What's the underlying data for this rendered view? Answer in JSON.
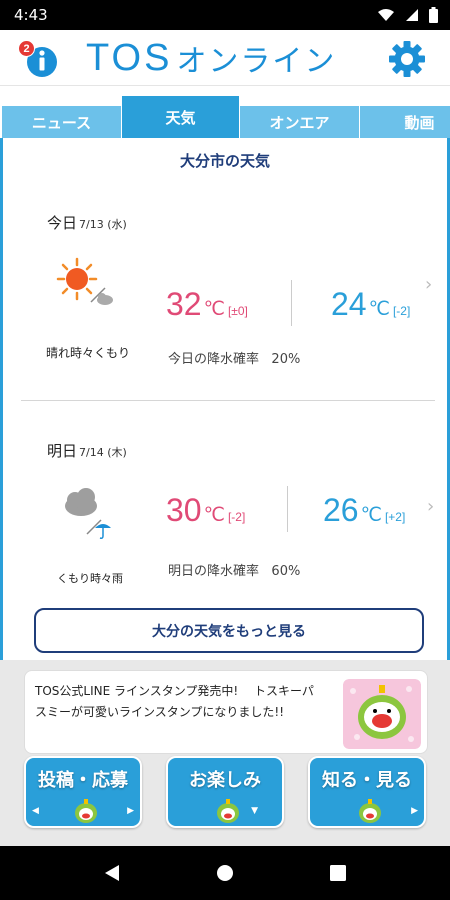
{
  "status_bar": {
    "time": "4:43"
  },
  "header": {
    "badge_count": "2",
    "logo_latin": "TOS",
    "logo_kana": "オンライン"
  },
  "tabs": [
    {
      "label": "ニュース",
      "active": false
    },
    {
      "label": "天気",
      "active": true
    },
    {
      "label": "オンエア",
      "active": false
    },
    {
      "label": "動画",
      "active": false
    }
  ],
  "weather": {
    "title": "大分市の天気",
    "today": {
      "label": "今日",
      "date": "7/13 (水)",
      "condition": "晴れ時々くもり",
      "icon": "sunny-then-cloudy-icon",
      "high": "32",
      "high_unit": "℃",
      "high_diff": "[±0]",
      "low": "24",
      "low_unit": "℃",
      "low_diff": "[-2]",
      "rain_label": "今日の降水確率",
      "rain_value": "20%"
    },
    "tomorrow": {
      "label": "明日",
      "date": "7/14 (木)",
      "condition": "くもり時々雨",
      "icon": "cloudy-then-rain-icon",
      "high": "30",
      "high_unit": "℃",
      "high_diff": "[-2]",
      "low": "26",
      "low_unit": "℃",
      "low_diff": "[+2]",
      "rain_label": "明日の降水確率",
      "rain_value": "60%"
    },
    "more_button": "大分の天気をもっと見る"
  },
  "banner": {
    "text": "TOS公式LINE ラインスタンプ発売中!　 トスキーパスミーが可愛いラインスタンプになりました!!"
  },
  "big_buttons": [
    {
      "label": "投稿・応募"
    },
    {
      "label": "お楽しみ"
    },
    {
      "label": "知る・見る"
    }
  ],
  "colors": {
    "accent": "#2a9fd9",
    "tab_inactive": "#6cc1ea",
    "high_temp": "#e04a76",
    "low_temp": "#2a9fd9",
    "navy": "#1f3d7a"
  }
}
